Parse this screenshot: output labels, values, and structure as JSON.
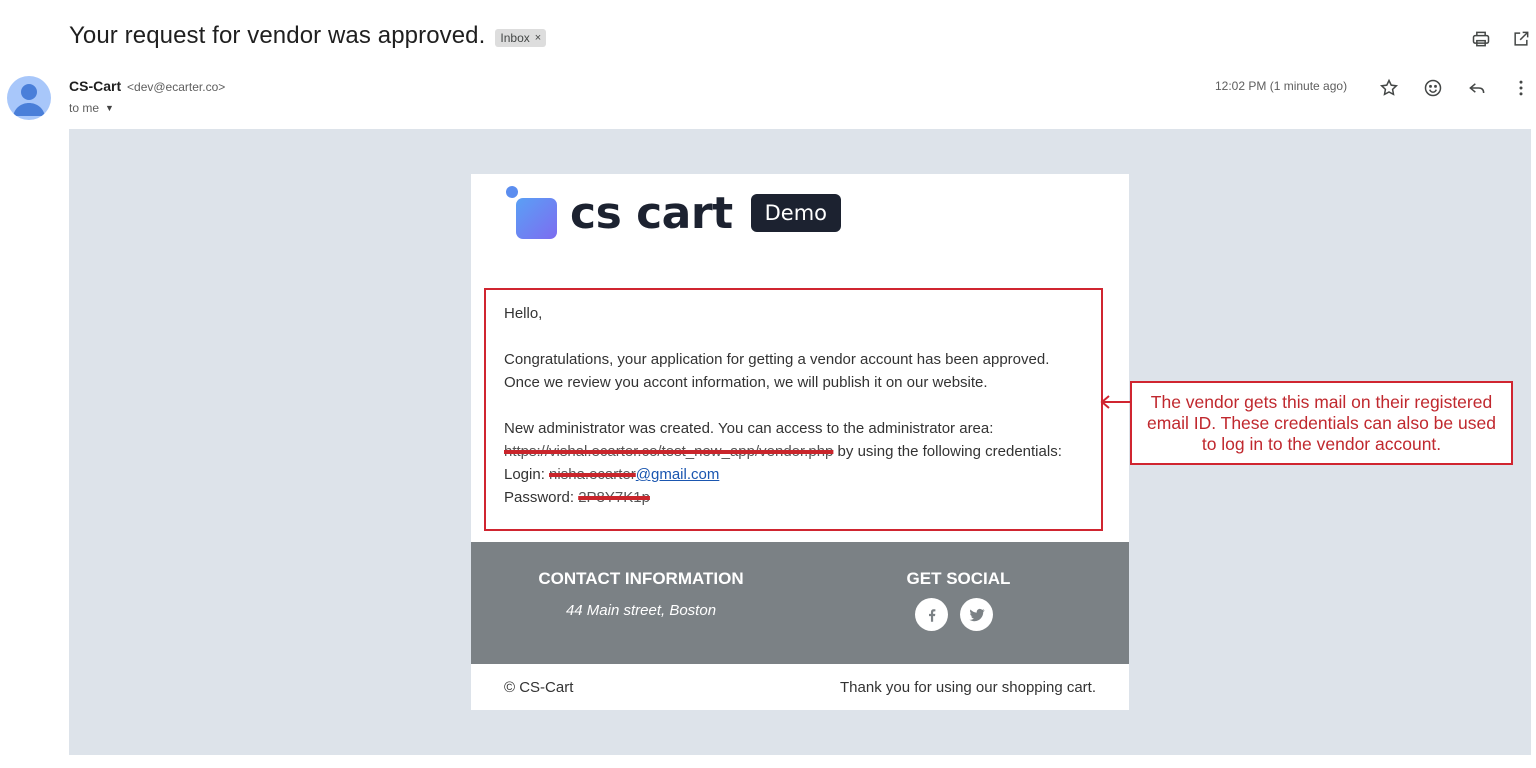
{
  "header": {
    "subject": "Your request for vendor was approved.",
    "label": "Inbox",
    "label_close": "×",
    "actions": [
      "print-icon",
      "open-in-new-window-icon"
    ]
  },
  "message": {
    "sender_name": "CS-Cart",
    "sender_email": "<dev@ecarter.co>",
    "to": "to me",
    "time": "12:02 PM (1 minute ago)",
    "actions": [
      "star-icon",
      "emoji-reaction-icon",
      "reply-icon",
      "more-options-icon"
    ]
  },
  "email": {
    "logo_text": "cs cart",
    "demo_badge": "Demo",
    "greeting": "Hello,",
    "para1_line1": "Congratulations, your application for getting a vendor account has been approved.",
    "para1_line2": "Once we review you accont information, we will publish it on our website.",
    "para2_line1": "New administrator was created. You can access to the administrator area:",
    "admin_url_redacted": "https://vishal.ecarter.co/test_new_app/vendor.php",
    "para2_line2_suffix": " by using the following credentials:",
    "login_label": "Login: ",
    "login_redacted": "nisha.ecarter",
    "login_domain": "@gmail.com",
    "password_label": "Password: ",
    "password_redacted": "2P8Y7K1p",
    "footer": {
      "contact_title": "CONTACT INFORMATION",
      "contact_address": "44 Main street, Boston",
      "social_title": "GET SOCIAL",
      "social_icons": [
        "facebook-icon",
        "twitter-icon"
      ]
    },
    "copyright": "© CS-Cart",
    "thanks": "Thank you for using our shopping cart."
  },
  "annotation": {
    "callout_text": "The vendor gets this mail on their registered email ID. These credentials can also be used to log in to the vendor account.",
    "color": "#d02530"
  }
}
